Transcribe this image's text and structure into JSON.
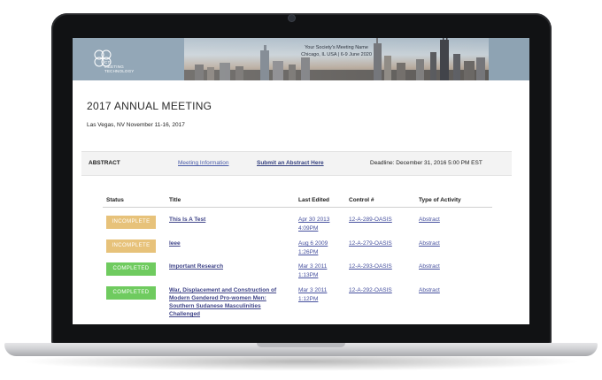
{
  "banner": {
    "logo_text_line1": "CTI",
    "logo_text_line2": "MEETING",
    "logo_text_line3": "TECHNOLOGY",
    "meeting_name": "Your Society's Meeting Name",
    "meeting_place": "Chicago, IL USA | 6-9 June 2020"
  },
  "page": {
    "title": "2017 ANNUAL MEETING",
    "location": "Las Vegas, NV November 11-16, 2017"
  },
  "nav": {
    "section": "ABSTRACT",
    "meeting_info": "Meeting Information",
    "submit": "Submit an Abstract Here",
    "deadline": "Deadline: December 31, 2016 5:00 PM EST"
  },
  "table": {
    "headers": [
      "Status",
      "Title",
      "Last Edited",
      "Control #",
      "Type of Activity"
    ],
    "rows": [
      {
        "status": "INCOMPLETE",
        "title": "This Is A Test",
        "edited_date": "Apr 30 2013",
        "edited_time": "4:09PM",
        "control": "12-A-289-OASIS",
        "type": "Abstract"
      },
      {
        "status": "INCOMPLETE",
        "title": "leee",
        "edited_date": "Aug 6 2009",
        "edited_time": "1:26PM",
        "control": "12-A-279-OASIS",
        "type": "Abstract"
      },
      {
        "status": "COMPLETED",
        "title": "Important Research",
        "edited_date": "Mar 3 2011",
        "edited_time": "1:13PM",
        "control": "12-A-293-OASIS",
        "type": "Abstract"
      },
      {
        "status": "COMPLETED",
        "title_line1": "War, Displacement and Construction of",
        "title_line2": "Modern Gendered Pro-women Men:",
        "title_line3": "Southern Sudanese Masculinities",
        "title_line4": "Challenged",
        "edited_date": "Mar 3 2011",
        "edited_time": "1:12PM",
        "control": "12-A-292-OASIS",
        "type": "Abstract"
      }
    ]
  },
  "colors": {
    "incomplete": "#e7c27a",
    "completed": "#6fcb5f",
    "link": "#46509e"
  }
}
